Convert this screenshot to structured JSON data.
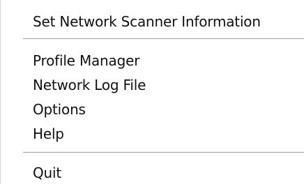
{
  "menu": {
    "items": [
      {
        "label": "Set Network Scanner Information"
      },
      {
        "label": "Profile Manager"
      },
      {
        "label": "Network Log File"
      },
      {
        "label": "Options"
      },
      {
        "label": "Help"
      },
      {
        "label": "Quit"
      }
    ]
  }
}
